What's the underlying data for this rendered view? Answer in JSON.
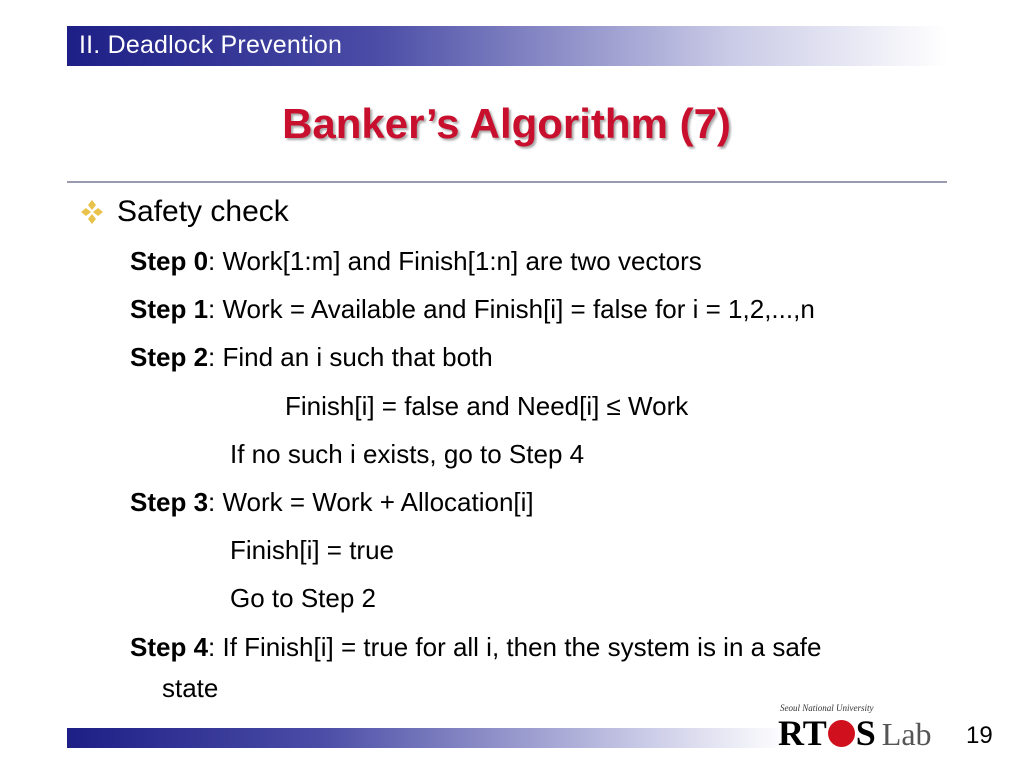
{
  "header": {
    "section": "II. Deadlock Prevention",
    "title": "Banker’s Algorithm (7)"
  },
  "bullet": {
    "text": "Safety check"
  },
  "steps": {
    "s0_label": "Step 0",
    "s0_text": ": Work[1:m] and Finish[1:n] are two vectors",
    "s1_label": "Step 1",
    "s1_text": ": Work = Available and Finish[i] = false for i = 1,2,...,n",
    "s2_label": "Step 2",
    "s2_text": ": Find an i such that both",
    "s2_cond": "Finish[i] = false and Need[i] ≤ Work",
    "s2_else": "If no such i exists, go to Step 4",
    "s3_label": "Step 3",
    "s3_text": ": Work = Work + Allocation[i]",
    "s3_line2": "Finish[i] = true",
    "s3_line3": "Go to Step 2",
    "s4_label": "Step 4",
    "s4_text": ": If Finish[i] = true for all i, then the system is in a safe",
    "s4_cont": "state"
  },
  "footer": {
    "logo_sub": "Seoul National University",
    "logo_r": "RT",
    "logo_s": "S",
    "logo_lab": "Lab",
    "page_number": "19"
  },
  "colors": {
    "title": "#c8102e",
    "header_bar": "#1e1f86",
    "bullet": "#e8c24a"
  }
}
